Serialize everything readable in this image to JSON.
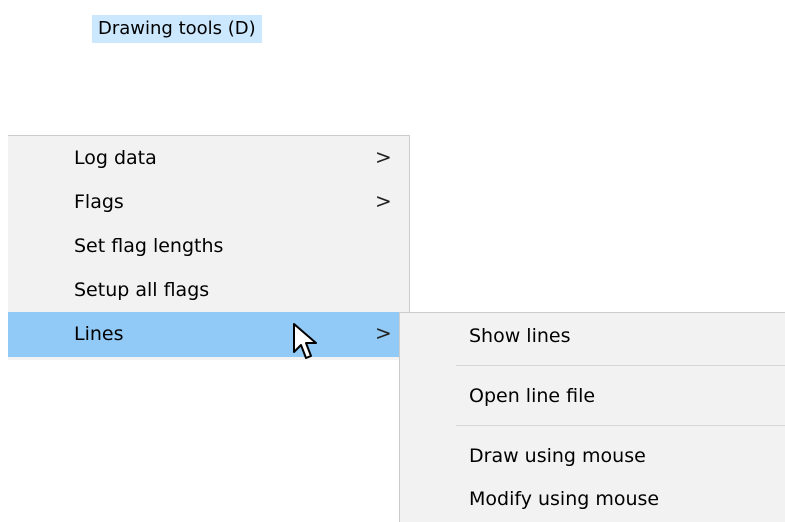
{
  "title": "Drawing tools (D)",
  "main_menu": {
    "items": [
      {
        "label": "Log data",
        "has_submenu": true,
        "arrow": ">"
      },
      {
        "label": "Flags",
        "has_submenu": true,
        "arrow": ">"
      },
      {
        "label": "Set flag lengths",
        "has_submenu": false
      },
      {
        "label": "Setup all flags",
        "has_submenu": false
      },
      {
        "label": "Lines",
        "has_submenu": true,
        "arrow": ">",
        "active": true
      }
    ]
  },
  "submenu": {
    "items": [
      {
        "label": "Show lines"
      },
      {
        "label": "Open line file"
      },
      {
        "label": "Draw using mouse"
      },
      {
        "label": "Modify using mouse"
      }
    ]
  },
  "colors": {
    "title_highlight": "#cce8ff",
    "menu_background": "#f2f2f2",
    "active_item": "#91c9f7",
    "separator": "#d7d7d7"
  },
  "icons": {
    "submenu_arrow": "chevron-right-icon",
    "cursor": "mouse-pointer-icon"
  }
}
